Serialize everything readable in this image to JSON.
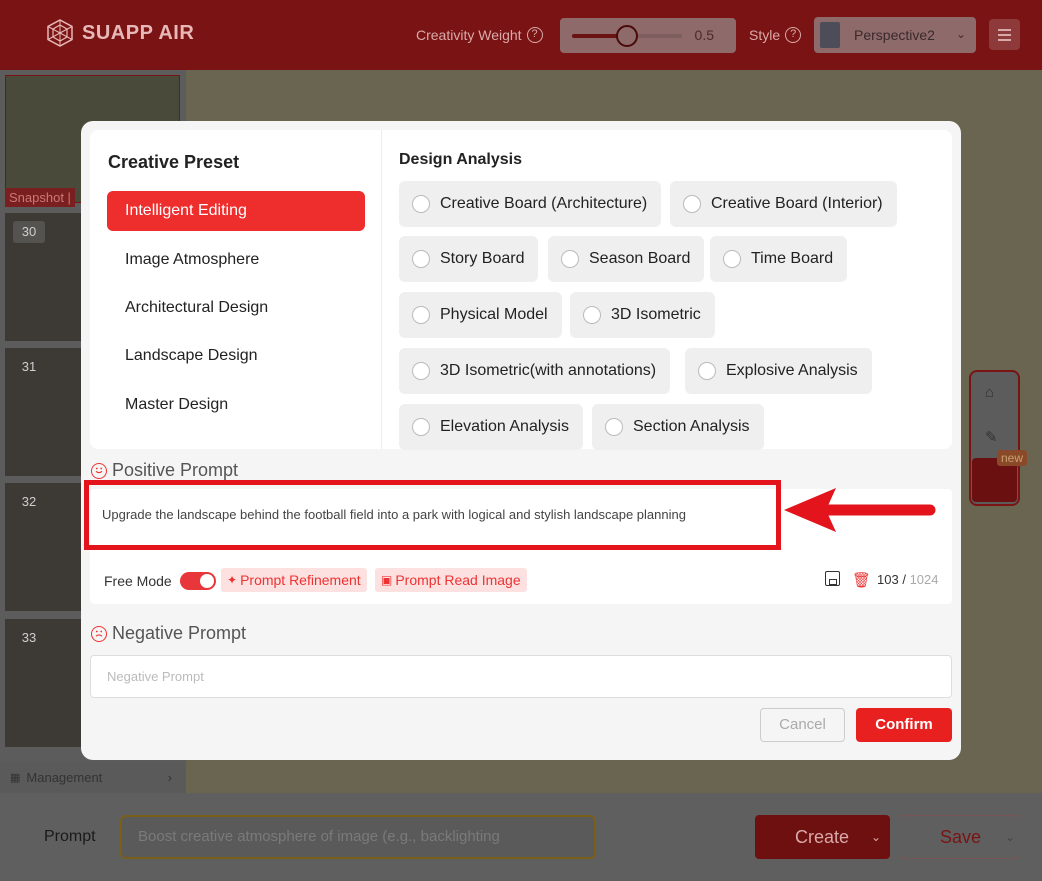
{
  "app": {
    "name": "SUAPP AIR",
    "creativity_label": "Creativity Weight",
    "creativity_value": "0.5",
    "creativity_fraction": 0.5,
    "style_label": "Style",
    "style_value": "Perspective2"
  },
  "sidebar": {
    "snapshot_label": "Snapshot |",
    "thumbs": [
      "30",
      "31",
      "32",
      "33"
    ],
    "management_label": "Management"
  },
  "right_tools": {
    "badge": "new"
  },
  "bottom": {
    "prompt_label": "Prompt",
    "prompt_placeholder": "Boost creative atmosphere of image (e.g., backlighting",
    "create_label": "Create",
    "save_label": "Save"
  },
  "modal": {
    "preset_title": "Creative Preset",
    "presets": [
      {
        "label": "Intelligent Editing",
        "active": true
      },
      {
        "label": "Image Atmosphere",
        "active": false
      },
      {
        "label": "Architectural Design",
        "active": false
      },
      {
        "label": "Landscape Design",
        "active": false
      },
      {
        "label": "Master Design",
        "active": false
      }
    ],
    "design_analysis_title": "Design Analysis",
    "options": [
      "Creative Board (Architecture)",
      "Creative Board (Interior)",
      "Story Board",
      "Season Board",
      "Time Board",
      "Physical Model",
      "3D Isometric",
      "3D Isometric(with annotations)",
      "Explosive Analysis",
      "Elevation Analysis",
      "Section Analysis"
    ],
    "positive_prompt_title": "Positive Prompt",
    "positive_prompt_text": "Upgrade the landscape behind the football field into a park with logical and stylish landscape planning",
    "free_mode_label": "Free Mode",
    "prompt_refinement_label": "Prompt Refinement",
    "prompt_read_image_label": "Prompt Read Image",
    "char_count": "103",
    "char_max": "1024",
    "negative_prompt_title": "Negative Prompt",
    "negative_prompt_placeholder": "Negative Prompt",
    "cancel_label": "Cancel",
    "confirm_label": "Confirm"
  },
  "colors": {
    "accent": "#ee2d2d",
    "highlight_annotation": "#e3141c"
  }
}
